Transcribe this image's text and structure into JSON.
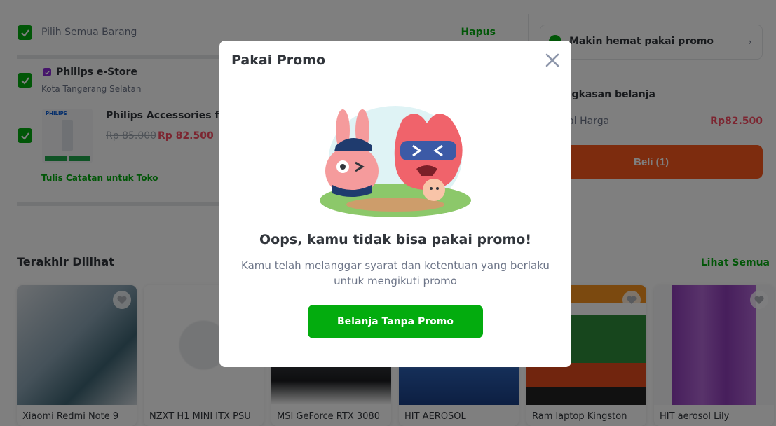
{
  "cart": {
    "select_all_label": "Pilih Semua Barang",
    "delete_label": "Hapus",
    "shop_name": "Philips e-Store",
    "shop_city": "Kota Tangerang Selatan",
    "product_name": "Philips Accessories for P",
    "price_old": "Rp 85.000",
    "price_new": "Rp 82.500",
    "note_link": "Tulis Catatan untuk Toko"
  },
  "summary": {
    "promo_text": "Makin hemat pakai promo",
    "title": "Ringkasan belanja",
    "total_label": "Total Harga",
    "total_value": "Rp82.500",
    "buy_label": "Beli (1)"
  },
  "recent": {
    "title": "Terakhir Dilihat",
    "see_all": "Lihat Semua",
    "items": [
      {
        "title": "Xiaomi Redmi Note 9"
      },
      {
        "title": "NZXT H1 MINI ITX PSU"
      },
      {
        "title": "MSI GeForce RTX 3080"
      },
      {
        "title": "HIT AEROSOL"
      },
      {
        "title": "Ram laptop Kingston"
      },
      {
        "title": "HIT aerosol Lily"
      }
    ]
  },
  "modal": {
    "title": "Pakai Promo",
    "heading": "Oops, kamu tidak bisa pakai promo!",
    "description": "Kamu telah melanggar syarat dan ketentuan yang berlaku untuk mengikuti promo",
    "button_label": "Belanja Tanpa Promo"
  },
  "colors": {
    "accent_green": "#03ac0e",
    "price_red": "#f94d63",
    "buy_orange": "#fa591d"
  }
}
